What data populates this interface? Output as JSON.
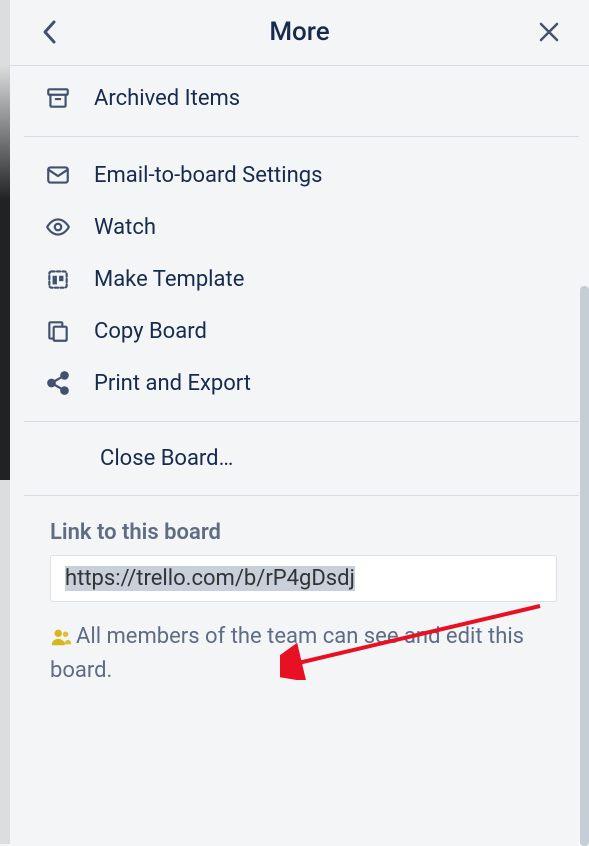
{
  "header": {
    "title": "More"
  },
  "groups": [
    {
      "items": [
        {
          "icon": "archive-icon",
          "label": "Archived Items"
        }
      ]
    },
    {
      "items": [
        {
          "icon": "mail-icon",
          "label": "Email-to-board Settings"
        },
        {
          "icon": "eye-icon",
          "label": "Watch"
        },
        {
          "icon": "template-icon",
          "label": "Make Template"
        },
        {
          "icon": "copy-icon",
          "label": "Copy Board"
        },
        {
          "icon": "share-icon",
          "label": "Print and Export"
        }
      ]
    }
  ],
  "close_board": {
    "label": "Close Board…"
  },
  "link_section": {
    "label": "Link to this board",
    "url": "https://trello.com/b/rP4gDsdj",
    "visibility_text": "All members of the team can see and edit this board."
  }
}
